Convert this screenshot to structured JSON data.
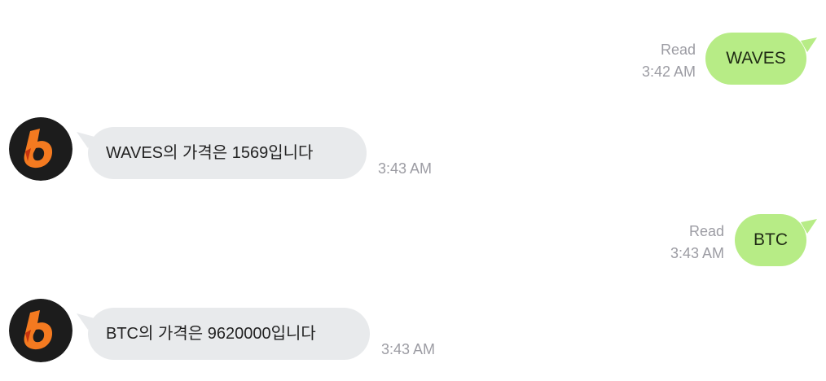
{
  "messages": [
    {
      "from": "user",
      "text": "WAVES",
      "status": "Read",
      "time": "3:42 AM"
    },
    {
      "from": "bot",
      "text": "WAVES의 가격은 1569입니다",
      "time": "3:43 AM"
    },
    {
      "from": "user",
      "text": "BTC",
      "status": "Read",
      "time": "3:43 AM"
    },
    {
      "from": "bot",
      "text": "BTC의 가격은 9620000입니다",
      "time": "3:43 AM"
    }
  ],
  "colors": {
    "user_bubble": "#b7ec86",
    "bot_bubble": "#e8eaec",
    "meta_text": "#9c9ca3",
    "avatar_bg": "#1c1c1c",
    "avatar_logo": "#f47a20"
  },
  "bot": {
    "avatar_icon": "bithumb-logo-icon"
  }
}
